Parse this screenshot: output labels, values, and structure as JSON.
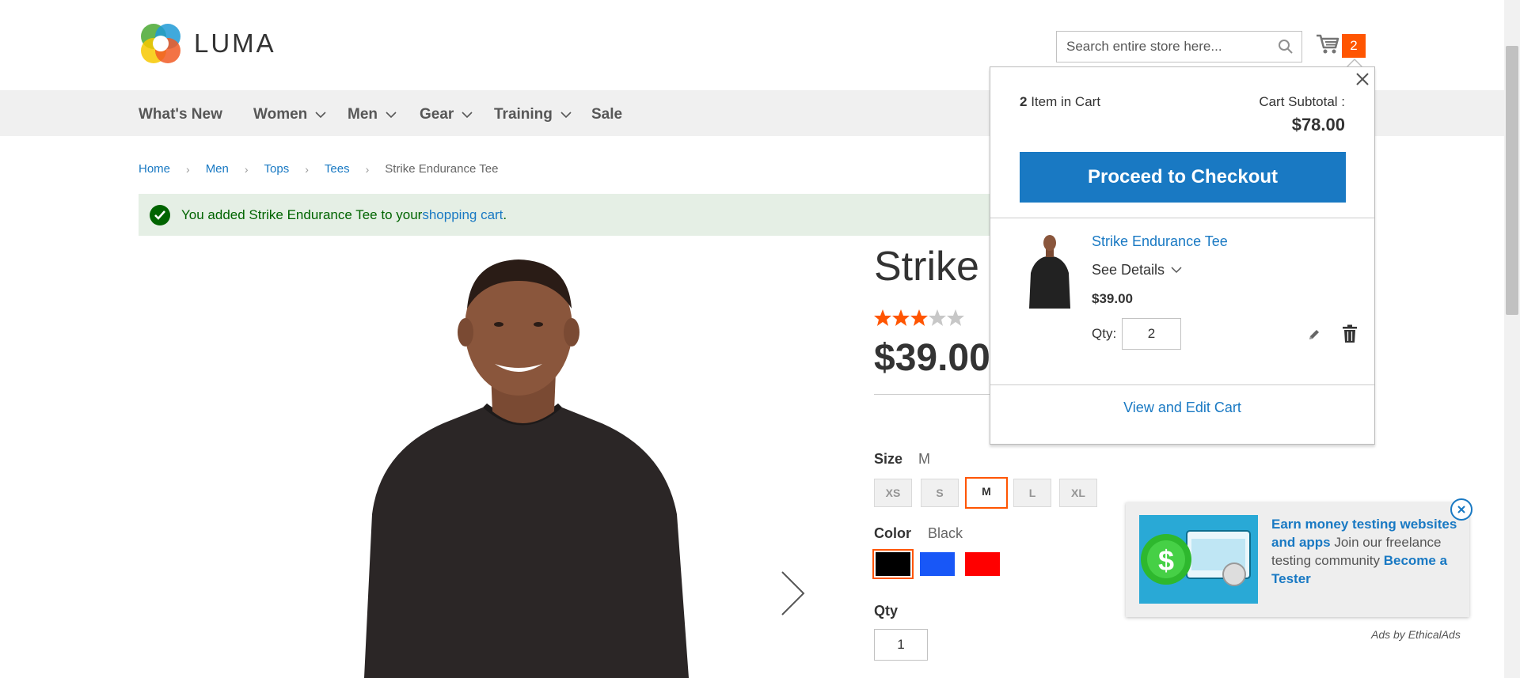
{
  "brand": {
    "name": "LUMA"
  },
  "search": {
    "placeholder": "Search entire store here..."
  },
  "cart": {
    "count": "2"
  },
  "nav": {
    "items": [
      {
        "label": "What's New",
        "has_dropdown": false
      },
      {
        "label": "Women",
        "has_dropdown": true
      },
      {
        "label": "Men",
        "has_dropdown": true
      },
      {
        "label": "Gear",
        "has_dropdown": true
      },
      {
        "label": "Training",
        "has_dropdown": true
      },
      {
        "label": "Sale",
        "has_dropdown": false
      }
    ]
  },
  "breadcrumb": {
    "items": [
      "Home",
      "Men",
      "Tops",
      "Tees"
    ],
    "current": "Strike Endurance Tee"
  },
  "message": {
    "prefix": "You added Strike Endurance Tee to your ",
    "link": "shopping cart",
    "suffix": "."
  },
  "product": {
    "name": "Strike Endurance Tee",
    "name_visible": "Strike I",
    "rating": 3,
    "rating_max": 5,
    "price": "$39.00",
    "size_label": "Size",
    "size_value": "M",
    "sizes": [
      "XS",
      "S",
      "M",
      "L",
      "XL"
    ],
    "color_label": "Color",
    "color_value": "Black",
    "colors": [
      "#000000",
      "#1857f7",
      "#ff0000"
    ],
    "qty_label": "Qty",
    "qty": "1"
  },
  "minicart": {
    "count": "2",
    "count_suffix": " Item in Cart",
    "subtotal_label": "Cart Subtotal :",
    "subtotal": "$78.00",
    "checkout_label": "Proceed to Checkout",
    "item": {
      "name": "Strike Endurance Tee",
      "details_label": "See Details",
      "price": "$39.00",
      "qty_label": "Qty:",
      "qty": "2"
    },
    "view_cart_label": "View and Edit Cart"
  },
  "ad": {
    "headline": "Earn money testing websites and apps",
    "body": " Join our freelance testing community ",
    "cta": "Become a Tester",
    "by": "Ads by EthicalAds"
  },
  "colors": {
    "accent": "#ff5501",
    "link": "#1979c3",
    "success_bg": "#e5efe5",
    "success_text": "#006400"
  }
}
